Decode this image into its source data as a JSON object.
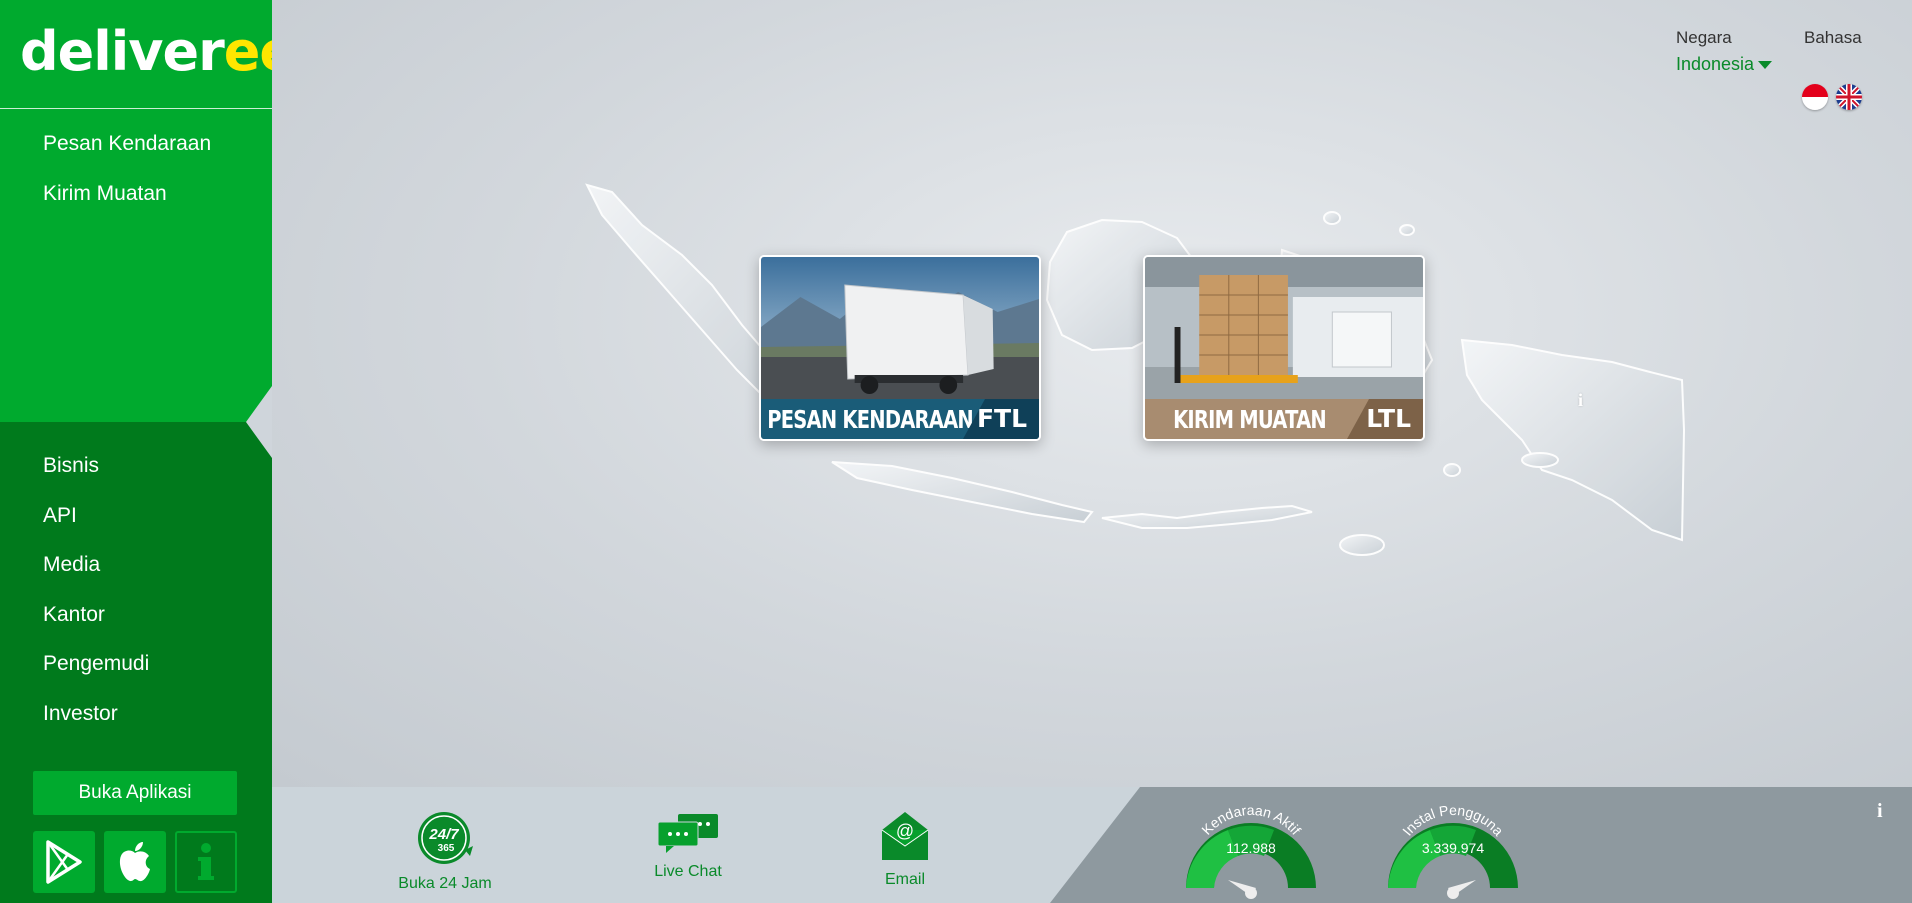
{
  "brand": {
    "name_main": "deliver",
    "name_accent": "ee",
    "tm": "™"
  },
  "sidebar": {
    "primary": [
      {
        "label": "Pesan Kendaraan"
      },
      {
        "label": "Kirim Muatan"
      }
    ],
    "secondary": [
      {
        "label": "Bisnis"
      },
      {
        "label": "API"
      },
      {
        "label": "Media"
      },
      {
        "label": "Kantor"
      },
      {
        "label": "Pengemudi"
      },
      {
        "label": "Investor"
      }
    ],
    "open_app_label": "Buka Aplikasi",
    "store_icons": [
      "google-play-icon",
      "apple-icon",
      "info-icon"
    ]
  },
  "locale": {
    "country_label": "Negara",
    "country_value": "Indonesia",
    "language_label": "Bahasa",
    "languages": [
      "indonesia-flag-icon",
      "uk-flag-icon"
    ]
  },
  "cards": {
    "ftl": {
      "title": "PESAN KENDARAAN",
      "tag": "FTL"
    },
    "ltl": {
      "title": "KIRIM MUATAN",
      "tag": "LTL"
    }
  },
  "footer": {
    "open24": {
      "badge_top": "24/7",
      "badge_bottom": "365",
      "label": "Buka 24 Jam"
    },
    "chat": {
      "label": "Live Chat"
    },
    "email": {
      "label": "Email"
    },
    "stats": [
      {
        "title": "Kendaraan Aktif",
        "value": "112.988"
      },
      {
        "title": "Instal Pengguna",
        "value": "3.339.974"
      }
    ],
    "info_glyph": "i"
  },
  "colors": {
    "primary_green": "#00aa2e",
    "dark_green": "#007a1c",
    "accent_yellow": "#ffe600",
    "ftl_blue": "#1a5c78",
    "ltl_brown": "#a88c70"
  }
}
